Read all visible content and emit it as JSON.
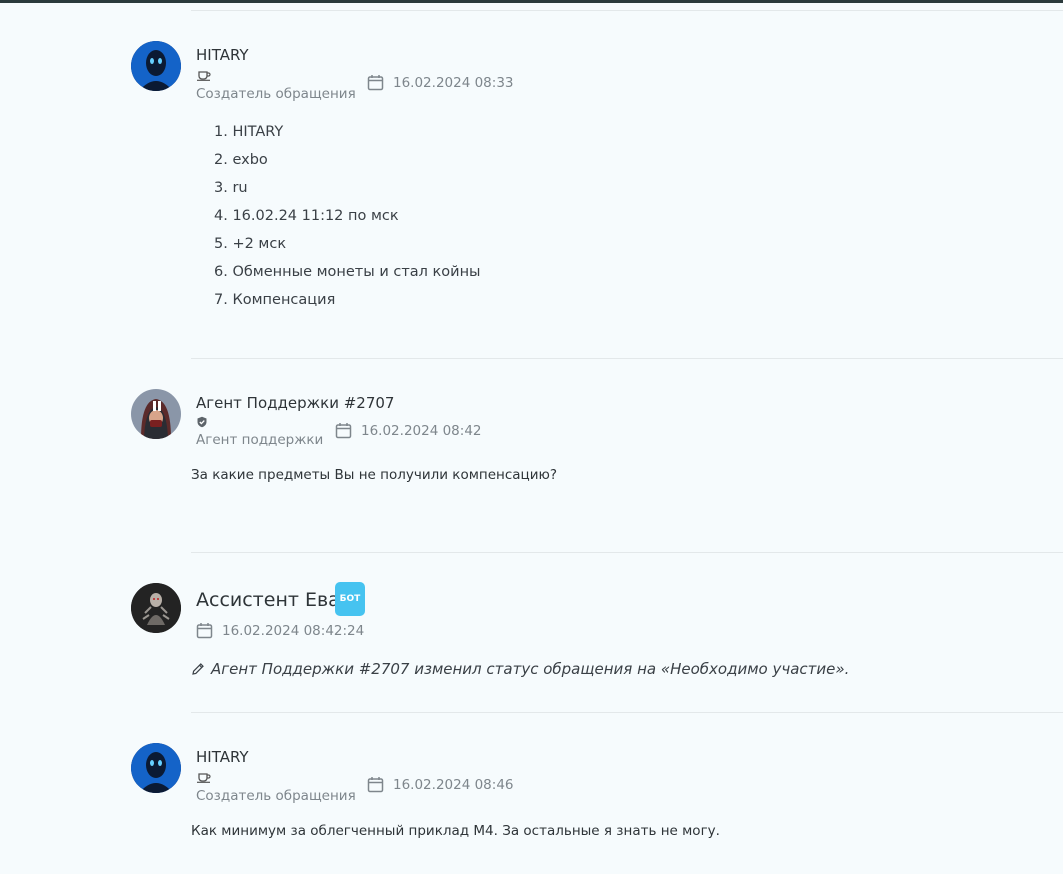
{
  "messages": [
    {
      "author": "HITARY",
      "role": "Создатель обращения",
      "date": "16.02.2024 08:33",
      "items": [
        "1. HITARY",
        "2. exbo",
        "3. ru",
        "4. 16.02.24 11:12 по мск",
        "5. +2 мск",
        "6. Обменные монеты и стал койны",
        "7. Компенсация"
      ]
    },
    {
      "author": "Агент Поддержки #2707",
      "role": "Агент поддержки",
      "date": "16.02.2024 08:42",
      "text": "За какие предметы Вы не получили компенсацию?"
    },
    {
      "author": "Ассистент Ева",
      "badge": "БОТ",
      "date": "16.02.2024 08:42:24",
      "text": "Агент Поддержки #2707 изменил статус обращения на «Необходимо участие»."
    },
    {
      "author": "HITARY",
      "role": "Создатель обращения",
      "date": "16.02.2024 08:46",
      "text": "Как минимум за облегченный приклад М4. За остальные я знать не могу."
    }
  ],
  "icons": {
    "calendar": "calendar-icon",
    "creator_badge": "cup-icon",
    "agent_badge": "shield-icon",
    "edit": "pencil-icon"
  },
  "colors": {
    "background": "#f6fbfd",
    "bot_badge": "#46c3f0",
    "muted_text": "#7e868c",
    "divider": "#e3e8ea"
  }
}
